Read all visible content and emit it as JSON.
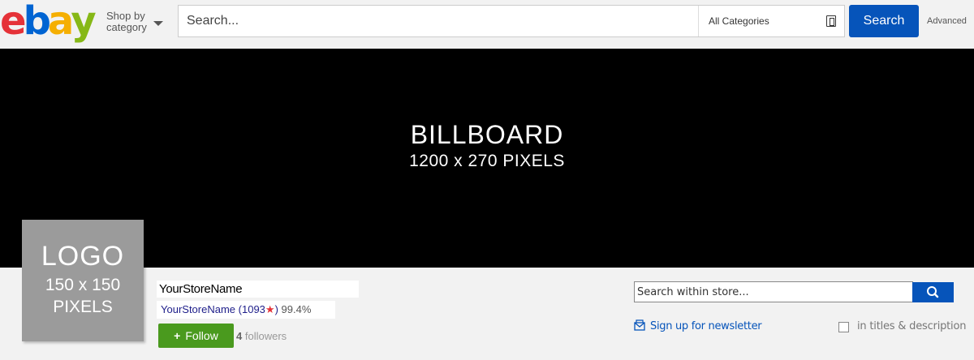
{
  "header": {
    "logo": {
      "letters": [
        {
          "char": "e",
          "color": "#e53238"
        },
        {
          "char": "b",
          "color": "#0064d2"
        },
        {
          "char": "a",
          "color": "#f5af02"
        },
        {
          "char": "y",
          "color": "#86b817"
        }
      ]
    },
    "shop_by_line1": "Shop by",
    "shop_by_line2": "category",
    "search_placeholder": "Search...",
    "category_selected": "All Categories",
    "search_button": "Search",
    "advanced_link": "Advanced"
  },
  "billboard": {
    "title": "BILLBOARD",
    "subtitle": "1200 x 270 PIXELS"
  },
  "store": {
    "logo_line1": "LOGO",
    "logo_line2": "150 x 150",
    "logo_line3": "PIXELS",
    "name": "YourStoreName",
    "seller_name": "YourStoreName",
    "feedback_open": "(",
    "feedback_score": "1093",
    "feedback_star": "★",
    "feedback_close": ")",
    "positive_percent": "99.4%",
    "follow_label": "Follow",
    "follow_plus": "+",
    "follower_count": "4",
    "followers_label": "followers",
    "search_placeholder": "Search within store...",
    "newsletter_label": "Sign up for newsletter",
    "titles_desc_label": "in titles & description"
  },
  "colors": {
    "brand_blue": "#0654ba",
    "follow_green": "#4a9a1e",
    "billboard_bg": "#000000",
    "logo_placeholder": "#9b9b9b"
  }
}
